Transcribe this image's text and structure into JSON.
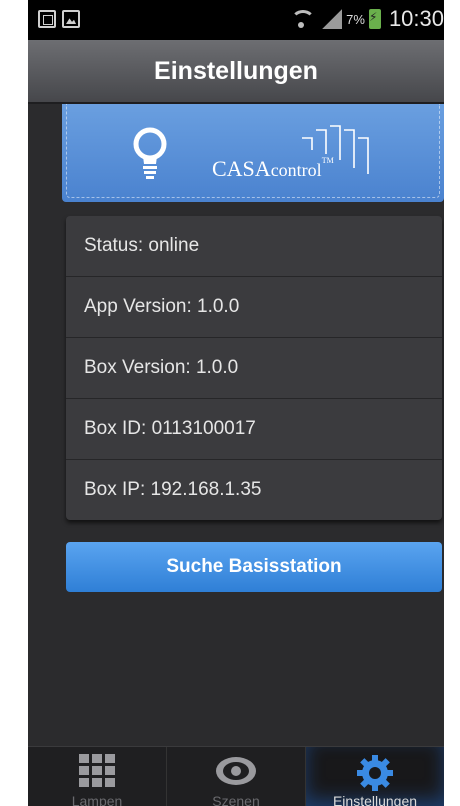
{
  "statusbar": {
    "battery": "7%",
    "time": "10:30"
  },
  "title": "Einstellungen",
  "logo": {
    "brand_main": "CASA",
    "brand_sub": "control",
    "trademark": "TM"
  },
  "info": [
    {
      "label": "Status: online"
    },
    {
      "label": "App Version: 1.0.0"
    },
    {
      "label": "Box Version: 1.0.0"
    },
    {
      "label": "Box ID: 0113100017"
    },
    {
      "label": "Box IP: 192.168.1.35"
    }
  ],
  "search_button": "Suche Basisstation",
  "tabs": [
    {
      "label": "Lampen",
      "icon": "grid-icon"
    },
    {
      "label": "Szenen",
      "icon": "eye-icon"
    },
    {
      "label": "Einstellungen",
      "icon": "gear-icon",
      "active": true
    }
  ],
  "colors": {
    "accent": "#3a8ae3",
    "banner": "#5a91da",
    "background": "#2b2b2d"
  }
}
